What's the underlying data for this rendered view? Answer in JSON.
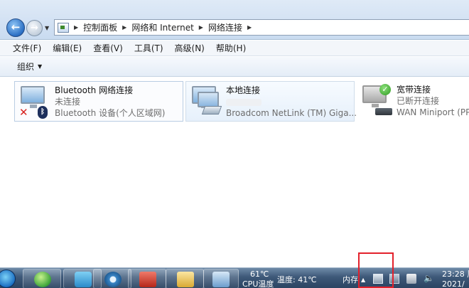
{
  "address": {
    "crumbs": [
      "控制面板",
      "网络和 Internet",
      "网络连接"
    ]
  },
  "menu": [
    "文件(F)",
    "编辑(E)",
    "查看(V)",
    "工具(T)",
    "高级(N)",
    "帮助(H)"
  ],
  "command": {
    "organize": "组织"
  },
  "connections": [
    {
      "name": "Bluetooth 网络连接",
      "status": "未连接",
      "device": "Bluetooth 设备(个人区域网)",
      "icon": "bluetooth-disconnected-icon"
    },
    {
      "name": "本地连接",
      "status": "",
      "device": "Broadcom NetLink (TM) Giga...",
      "icon": "local-network-icon"
    },
    {
      "name": "宽带连接",
      "status": "已断开连接",
      "device": "WAN Miniport (PPP",
      "icon": "broadband-icon"
    }
  ],
  "taskbar": {
    "cpu_temp": "61℃",
    "cpu_label": "CPU温度",
    "temp_label": "温度: 41℃",
    "mem_label": "内存",
    "time": "23:28",
    "time_suffix": "周",
    "date": "2021/"
  },
  "colors": {
    "highlight": "#e3212b",
    "taskbar": "#3d5878"
  }
}
